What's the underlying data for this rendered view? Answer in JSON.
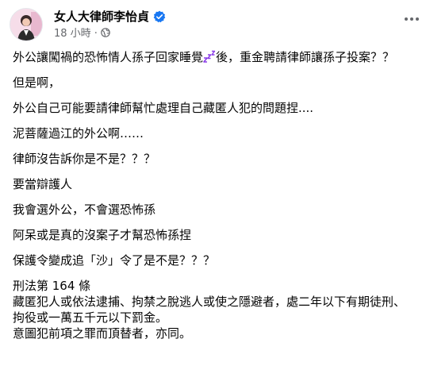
{
  "post": {
    "author": "女人大律師李怡貞",
    "timestamp": "18 小時",
    "separator": "·",
    "icons": {
      "verified": "verified-badge-icon",
      "privacy": "globe-icon",
      "more": "more-options-icon",
      "emoji": "zzz-sleeping-emoji-icon"
    },
    "colors": {
      "verified": "#1877f2",
      "meta_text": "#65676b",
      "body_text": "#050505",
      "emoji": "#8b3ee8"
    },
    "body": {
      "line1_before": "外公讓闖禍的恐怖情人孫子回家睡覺",
      "line1_after": "後，重金聘請律師讓孫子投案？？",
      "p2": "但是啊，",
      "p3": "外公自己可能要請律師幫忙處理自己藏匿人犯的問題捏....",
      "p4": "泥菩薩過江的外公啊……",
      "p5": "律師沒告訴你是不是？？？",
      "p6": "要當辯護人",
      "p7": "我會選外公，不會選恐怖孫",
      "p8": "阿呆或是真的沒案子才幫恐怖孫捏",
      "p9": "保護令變成追「沙」令了是不是？？？",
      "law_title": "刑法第 164 條",
      "law_line1": "藏匿犯人或依法逮捕、拘禁之脫逃人或使之隱避者，處二年以下有期徒刑、拘役或一萬五千元以下罰金。",
      "law_line2": "意圖犯前項之罪而頂替者，亦同。"
    }
  }
}
